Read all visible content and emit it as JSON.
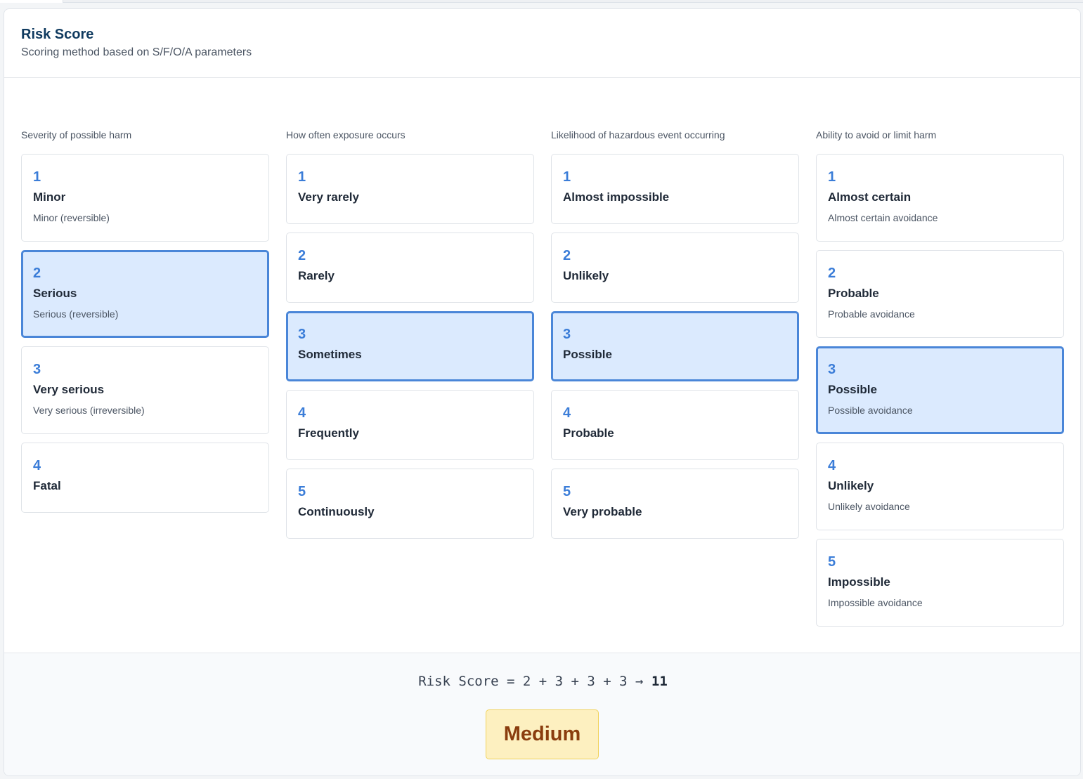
{
  "header": {
    "title": "Risk Score",
    "subtitle": "Scoring method based on S/F/O/A parameters"
  },
  "columns": [
    {
      "label": "Severity of possible harm",
      "options": [
        {
          "value": "1",
          "label": "Minor",
          "description": "Minor (reversible)"
        },
        {
          "value": "2",
          "label": "Serious",
          "description": "Serious (reversible)",
          "selected": true
        },
        {
          "value": "3",
          "label": "Very serious",
          "description": "Very serious (irreversible)"
        },
        {
          "value": "4",
          "label": "Fatal",
          "description": ""
        }
      ]
    },
    {
      "label": "How often exposure occurs",
      "options": [
        {
          "value": "1",
          "label": "Very rarely",
          "description": ""
        },
        {
          "value": "2",
          "label": "Rarely",
          "description": ""
        },
        {
          "value": "3",
          "label": "Sometimes",
          "description": "",
          "selected": true
        },
        {
          "value": "4",
          "label": "Frequently",
          "description": ""
        },
        {
          "value": "5",
          "label": "Continuously",
          "description": ""
        }
      ]
    },
    {
      "label": "Likelihood of hazardous event occurring",
      "options": [
        {
          "value": "1",
          "label": "Almost impossible",
          "description": ""
        },
        {
          "value": "2",
          "label": "Unlikely",
          "description": ""
        },
        {
          "value": "3",
          "label": "Possible",
          "description": "",
          "selected": true
        },
        {
          "value": "4",
          "label": "Probable",
          "description": ""
        },
        {
          "value": "5",
          "label": "Very probable",
          "description": ""
        }
      ]
    },
    {
      "label": "Ability to avoid or limit harm",
      "options": [
        {
          "value": "1",
          "label": "Almost certain",
          "description": "Almost certain avoidance"
        },
        {
          "value": "2",
          "label": "Probable",
          "description": "Probable avoidance"
        },
        {
          "value": "3",
          "label": "Possible",
          "description": "Possible avoidance",
          "selected": true
        },
        {
          "value": "4",
          "label": "Unlikely",
          "description": "Unlikely avoidance"
        },
        {
          "value": "5",
          "label": "Impossible",
          "description": "Impossible avoidance"
        }
      ]
    }
  ],
  "result": {
    "formula": "Risk Score = 2 + 3 + 3 + 3 → ",
    "total": "11",
    "level": "Medium"
  }
}
